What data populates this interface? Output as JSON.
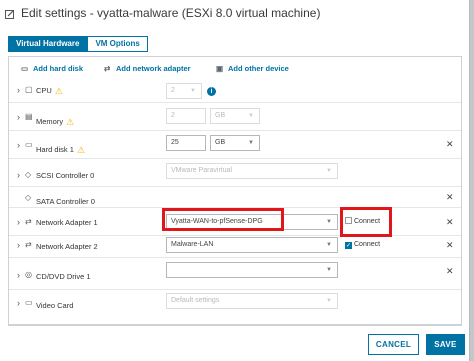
{
  "window": {
    "title": "Edit settings - vyatta-malware (ESXi 8.0 virtual machine)"
  },
  "tabs": [
    {
      "label": "Virtual Hardware",
      "active": true
    },
    {
      "label": "VM Options",
      "active": false
    }
  ],
  "toolbar": {
    "add_hard_disk": "Add hard disk",
    "add_network_adapter": "Add network adapter",
    "add_other_device": "Add other device"
  },
  "rows": {
    "cpu": {
      "label": "CPU",
      "value": "2"
    },
    "memory": {
      "label": "Memory",
      "value": "2",
      "unit": "GB"
    },
    "hard_disk": {
      "label": "Hard disk 1",
      "value": "25",
      "unit": "GB"
    },
    "scsi": {
      "label": "SCSI Controller 0",
      "value": "VMware Paravirtual"
    },
    "sata": {
      "label": "SATA Controller 0"
    },
    "net1": {
      "label": "Network Adapter 1",
      "value": "Vyatta-WAN-to-pfSense-DPG",
      "connect_label": "Connect",
      "connected": false
    },
    "net2": {
      "label": "Network Adapter 2",
      "value": "Malware-LAN",
      "connect_label": "Connect",
      "connected": true
    },
    "cd": {
      "label": "CD/DVD Drive 1",
      "value": ""
    },
    "video": {
      "label": "Video Card",
      "value": "Default settings"
    }
  },
  "footer": {
    "cancel_label": "CANCEL",
    "save_label": "SAVE"
  },
  "colors": {
    "accent": "#0072a3",
    "warning": "#f2b300",
    "highlight": "#e0161a"
  },
  "icons": {
    "title": "edit-settings-icon",
    "warning": "warning-triangle-icon",
    "info": "info-icon",
    "remove": "close-icon"
  }
}
